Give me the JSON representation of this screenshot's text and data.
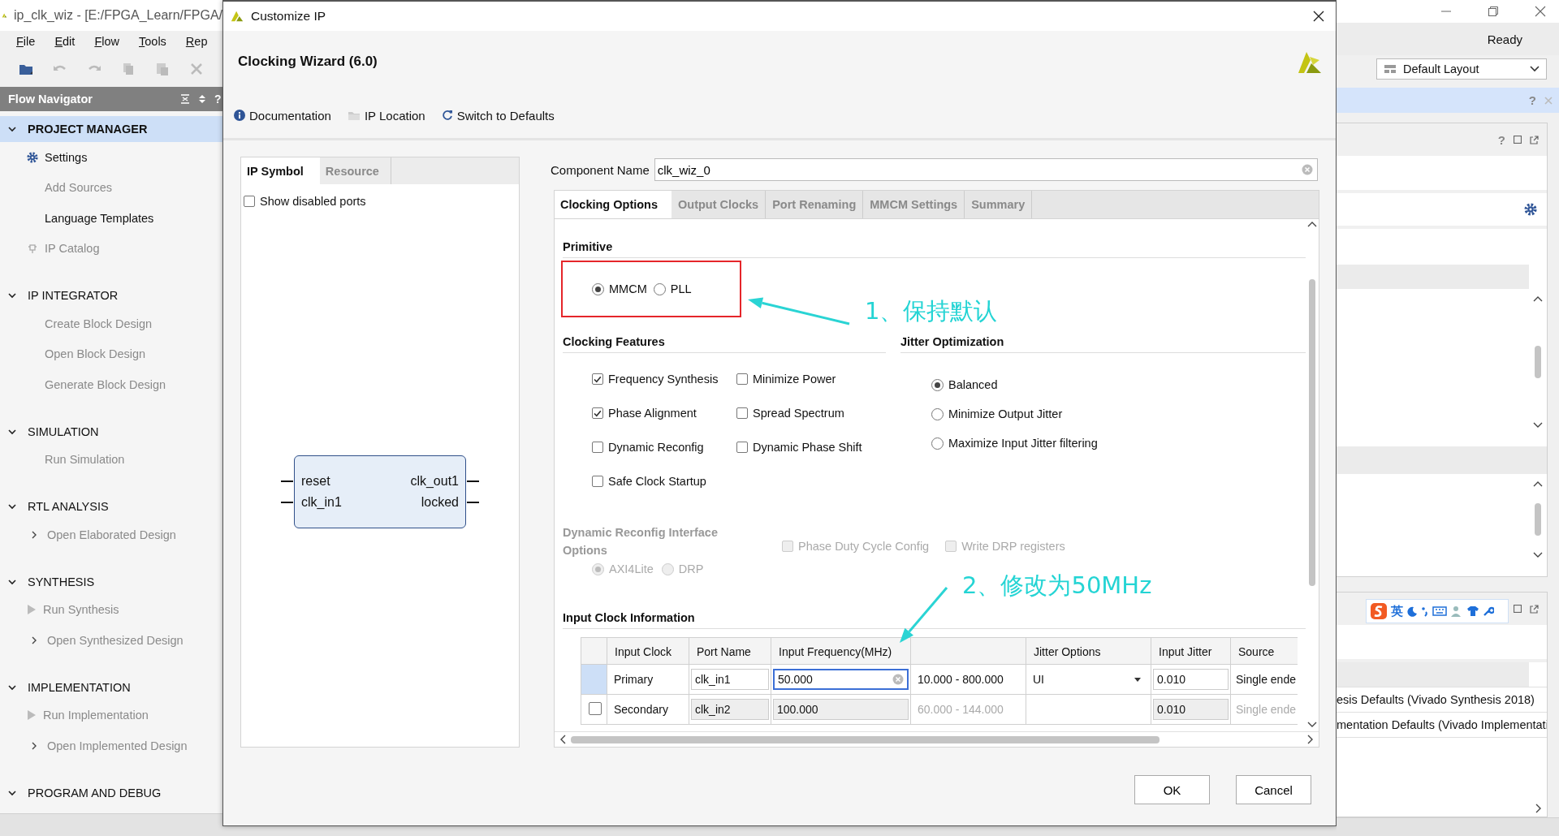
{
  "app_window": {
    "title": "ip_clk_wiz - [E:/FPGA_Learn/FPGA/",
    "menu": [
      "File",
      "Edit",
      "Flow",
      "Tools",
      "Rep"
    ],
    "status": "Ready",
    "layout_selector": "Default Layout"
  },
  "flow_navigator": {
    "title": "Flow Navigator",
    "help": "?",
    "sections": [
      {
        "label": "PROJECT MANAGER",
        "expanded": true,
        "selected": true,
        "items": [
          {
            "label": "Settings",
            "kind": "gear",
            "disabled": false
          },
          {
            "label": "Add Sources",
            "kind": "plain",
            "disabled": true
          },
          {
            "label": "Language Templates",
            "kind": "plain",
            "disabled": false
          },
          {
            "label": "IP Catalog",
            "kind": "chip",
            "disabled": true
          }
        ]
      },
      {
        "label": "IP INTEGRATOR",
        "expanded": true,
        "selected": false,
        "items": [
          {
            "label": "Create Block Design",
            "kind": "plain",
            "disabled": true
          },
          {
            "label": "Open Block Design",
            "kind": "plain",
            "disabled": true
          },
          {
            "label": "Generate Block Design",
            "kind": "plain",
            "disabled": true
          }
        ]
      },
      {
        "label": "SIMULATION",
        "expanded": true,
        "selected": false,
        "items": [
          {
            "label": "Run Simulation",
            "kind": "plain",
            "disabled": true
          }
        ]
      },
      {
        "label": "RTL ANALYSIS",
        "expanded": true,
        "selected": false,
        "items": [
          {
            "label": "Open Elaborated Design",
            "kind": "chevron",
            "disabled": true
          }
        ]
      },
      {
        "label": "SYNTHESIS",
        "expanded": true,
        "selected": false,
        "items": [
          {
            "label": "Run Synthesis",
            "kind": "run",
            "disabled": true
          },
          {
            "label": "Open Synthesized Design",
            "kind": "chevron",
            "disabled": true
          }
        ]
      },
      {
        "label": "IMPLEMENTATION",
        "expanded": true,
        "selected": false,
        "items": [
          {
            "label": "Run Implementation",
            "kind": "run",
            "disabled": true
          },
          {
            "label": "Open Implemented Design",
            "kind": "chevron",
            "disabled": true
          }
        ]
      },
      {
        "label": "PROGRAM AND DEBUG",
        "expanded": true,
        "selected": false
      }
    ]
  },
  "dialog": {
    "title": "Customize IP",
    "heading": "Clocking Wizard (6.0)",
    "links": [
      {
        "label": "Documentation",
        "kind": "info"
      },
      {
        "label": "IP Location",
        "kind": "folder"
      },
      {
        "label": "Switch to Defaults",
        "kind": "refresh"
      }
    ],
    "side_tabs": [
      {
        "label": "IP Symbol",
        "selected": true
      },
      {
        "label": "Resource",
        "selected": false
      }
    ],
    "show_disabled_ports": {
      "label": "Show disabled ports",
      "checked": false
    },
    "ip_symbol": {
      "inputs": [
        "reset",
        "clk_in1"
      ],
      "outputs": [
        "clk_out1",
        "locked"
      ]
    },
    "component_name": {
      "label": "Component Name",
      "value": "clk_wiz_0"
    },
    "tabs": [
      {
        "label": "Clocking Options",
        "selected": true
      },
      {
        "label": "Output Clocks",
        "selected": false
      },
      {
        "label": "Port Renaming",
        "selected": false
      },
      {
        "label": "MMCM Settings",
        "selected": false
      },
      {
        "label": "Summary",
        "selected": false
      }
    ],
    "primitive": {
      "title": "Primitive",
      "options": [
        {
          "label": "MMCM",
          "selected": true
        },
        {
          "label": "PLL",
          "selected": false
        }
      ]
    },
    "clocking_features": {
      "title": "Clocking Features",
      "options": [
        {
          "label": "Frequency Synthesis",
          "checked": true
        },
        {
          "label": "Minimize Power",
          "checked": false
        },
        {
          "label": "Phase Alignment",
          "checked": true
        },
        {
          "label": "Spread Spectrum",
          "checked": false
        },
        {
          "label": "Dynamic Reconfig",
          "checked": false
        },
        {
          "label": "Dynamic Phase Shift",
          "checked": false
        },
        {
          "label": "Safe Clock Startup",
          "checked": false
        }
      ]
    },
    "jitter_optimization": {
      "title": "Jitter Optimization",
      "options": [
        {
          "label": "Balanced",
          "selected": true
        },
        {
          "label": "Minimize Output Jitter",
          "selected": false
        },
        {
          "label": "Maximize Input Jitter filtering",
          "selected": false
        }
      ]
    },
    "dynamic_reconfig_interface": {
      "title": "Dynamic Reconfig Interface Options",
      "disabled": true,
      "interfaces": [
        {
          "label": "AXI4Lite",
          "selected": true
        },
        {
          "label": "DRP",
          "selected": false
        }
      ],
      "options": [
        {
          "label": "Phase Duty Cycle Config",
          "checked": false
        },
        {
          "label": "Write DRP registers",
          "checked": false
        }
      ]
    },
    "input_clock_information": {
      "title": "Input Clock Information",
      "headers": {
        "name": "Input Clock",
        "port": "Port Name",
        "frequency": "Input Frequency(MHz)",
        "jitter_option": "Jitter Options",
        "input_jitter": "Input Jitter",
        "source": "Source"
      },
      "rows": [
        {
          "kind": "primary",
          "name": "Primary",
          "port": "clk_in1",
          "frequency": "50.000",
          "focused": true,
          "range": "10.000 - 800.000",
          "jitter_option": "UI",
          "input_jitter": "0.010",
          "source": "Single ende"
        },
        {
          "kind": "secondary",
          "checked": false,
          "name": "Secondary",
          "port": "clk_in2",
          "frequency": "100.000",
          "focused": false,
          "range": "60.000 - 144.000",
          "input_jitter": "0.010",
          "source": "Single ende"
        }
      ]
    },
    "buttons": [
      {
        "label": "OK"
      },
      {
        "label": "Cancel"
      }
    ],
    "annotations": [
      {
        "text": "1、保持默认"
      },
      {
        "text": "2、修改为50MHz"
      }
    ]
  },
  "right_area": {
    "help": [
      "?",
      "?"
    ],
    "ime_label": "英",
    "rows": [
      "esis Defaults (Vivado Synthesis 2018)",
      "mentation Defaults (Vivado Implementati"
    ]
  }
}
